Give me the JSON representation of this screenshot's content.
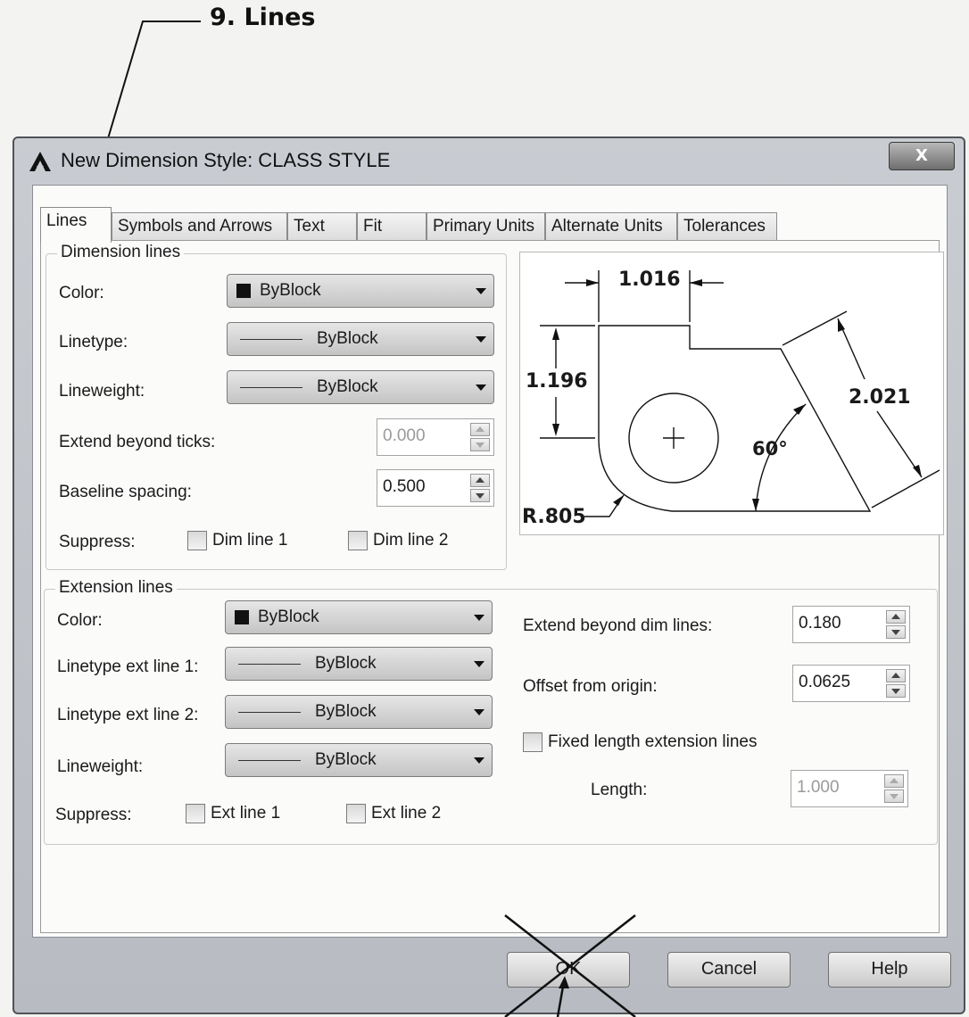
{
  "annotation": {
    "label": "9. Lines"
  },
  "window": {
    "title": "New Dimension Style: CLASS STYLE",
    "close_label": "X"
  },
  "tabs": [
    {
      "label": "Lines",
      "active": true
    },
    {
      "label": "Symbols and Arrows"
    },
    {
      "label": "Text"
    },
    {
      "label": "Fit"
    },
    {
      "label": "Primary Units"
    },
    {
      "label": "Alternate Units"
    },
    {
      "label": "Tolerances"
    }
  ],
  "dimension_lines": {
    "group_label": "Dimension lines",
    "color": {
      "label": "Color:",
      "value": "ByBlock",
      "swatch": "#111111"
    },
    "linetype": {
      "label": "Linetype:",
      "value": "ByBlock"
    },
    "lineweight": {
      "label": "Lineweight:",
      "value": "ByBlock"
    },
    "extend_beyond_ticks": {
      "label": "Extend beyond ticks:",
      "value": "0.000",
      "enabled": false
    },
    "baseline_spacing": {
      "label": "Baseline spacing:",
      "value": "0.500"
    },
    "suppress": {
      "label": "Suppress:",
      "dim_line_1": "Dim line 1",
      "dim_line_2": "Dim line 2"
    }
  },
  "extension_lines": {
    "group_label": "Extension lines",
    "color": {
      "label": "Color:",
      "value": "ByBlock"
    },
    "linetype_ext_line_1": {
      "label": "Linetype ext line 1:",
      "value": "ByBlock"
    },
    "linetype_ext_line_2": {
      "label": "Linetype ext line 2:",
      "value": "ByBlock"
    },
    "lineweight": {
      "label": "Lineweight:",
      "value": "ByBlock"
    },
    "suppress": {
      "label": "Suppress:",
      "ext_line_1": "Ext line 1",
      "ext_line_2": "Ext line 2"
    },
    "extend_beyond_dim_lines": {
      "label": "Extend beyond dim lines:",
      "value": "0.180"
    },
    "offset_from_origin": {
      "label": "Offset from origin:",
      "value": "0.0625"
    },
    "fixed_length": {
      "label": "Fixed length extension lines",
      "checked": false
    },
    "length": {
      "label": "Length:",
      "value": "1.000",
      "enabled": false
    }
  },
  "preview": {
    "dim_top": "1.016",
    "dim_left": "1.196",
    "dim_right": "2.021",
    "angle": "60°",
    "radius": "R.805"
  },
  "buttons": {
    "ok": "OK",
    "cancel": "Cancel",
    "help": "Help"
  }
}
